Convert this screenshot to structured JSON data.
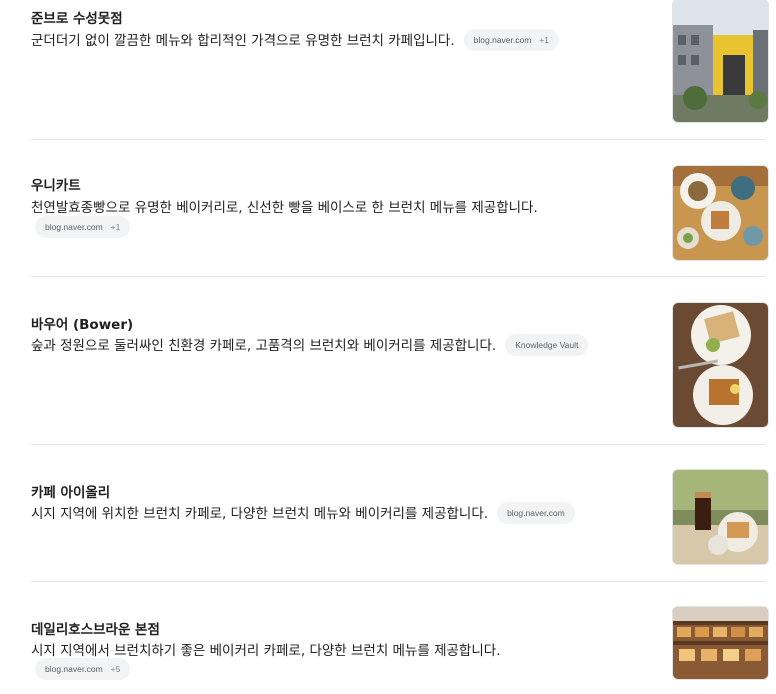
{
  "results": [
    {
      "title": "준브로 수성못점",
      "description": "군더더기 없이 깔끔한 메뉴와 합리적인 가격으로 유명한 브런치 카페입니다.",
      "source": "blog.naver.com",
      "more": "+1",
      "image_icon": "building-exterior-photo"
    },
    {
      "title": "우니카트",
      "description": "천연발효종빵으로 유명한 베이커리로, 신선한 빵을 베이스로 한 브런치 메뉴를 제공합니다.",
      "source": "blog.naver.com",
      "more": "+1",
      "image_icon": "brunch-table-photo"
    },
    {
      "title": "바우어 (Bower)",
      "description": "숲과 정원으로 둘러싸인 친환경 카페로, 고품격의 브런치와 베이커리를 제공합니다.",
      "source": "Knowledge Vault",
      "more": "",
      "image_icon": "brunch-plates-photo"
    },
    {
      "title": "카페 아이올리",
      "description": "시지 지역에 위치한 브런치 카페로, 다양한 브런치 메뉴와 베이커리를 제공합니다.",
      "source": "blog.naver.com",
      "more": "",
      "image_icon": "iced-coffee-photo"
    },
    {
      "title": "데일리호스브라운 본점",
      "description": "시지 지역에서 브런치하기 좋은 베이커리 카페로, 다양한 브런치 메뉴를 제공합니다.",
      "source": "blog.naver.com",
      "more": "+5",
      "image_icon": "bakery-display-photo"
    }
  ]
}
